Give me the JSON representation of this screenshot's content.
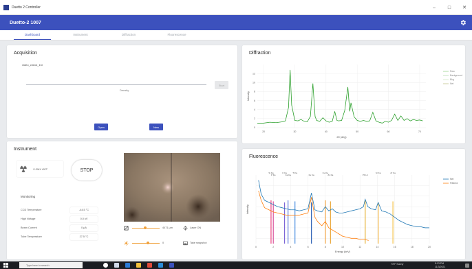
{
  "window": {
    "title": "Duetto 2 Controller",
    "minimize": "–",
    "maximize": "□",
    "close": "✕"
  },
  "appbar": {
    "title": "Duetto-2 1007",
    "settings_icon": "gear-icon"
  },
  "tabs": [
    {
      "label": "Dashboard",
      "active": true
    },
    {
      "label": "Instrument",
      "active": false
    },
    {
      "label": "Diffraction",
      "active": false
    },
    {
      "label": "Fluorescence",
      "active": false
    }
  ],
  "acquisition": {
    "title": "Acquisition",
    "filename": "video_check_1hr",
    "slider_label": "Density",
    "start_label": "Start",
    "open_label": "Open",
    "new_label": "New"
  },
  "instrument": {
    "title": "Instrument",
    "xray_label": "X-RAY OFF",
    "stop_label": "STOP",
    "monitoring_title": "Monitoring",
    "monitoring": [
      {
        "label": "CCD Temperature",
        "value": "-44.5 °C"
      },
      {
        "label": "High Voltage",
        "value": "0.0 kV"
      },
      {
        "label": "Beam Current",
        "value": "0 µA"
      },
      {
        "label": "Tube Temperature",
        "value": "27.5 °C"
      }
    ],
    "camera": {
      "focus_value": "4471 µm",
      "laser_label": "Laser ON",
      "light_value": "0",
      "snapshot_label": "Take snapshot"
    }
  },
  "diffraction": {
    "title": "Diffraction",
    "chart_data": {
      "type": "line",
      "title": "",
      "xlabel": "2θ (deg)",
      "ylabel": "Intensity",
      "xlim": [
        18,
        72
      ],
      "ylim": [
        0,
        14
      ],
      "xticks": [
        20,
        30,
        40,
        50,
        60,
        70
      ],
      "yticks": [
        0,
        2,
        4,
        6,
        8,
        10,
        12
      ],
      "legend": [
        "Raw",
        "Background",
        "Bkg",
        "Net"
      ],
      "legend_colors": [
        "#9bd48f",
        "#b8dfb0",
        "#cfe8c7",
        "#c3c58c"
      ],
      "series": [
        {
          "name": "Raw",
          "color": "#2ca02c",
          "points": [
            [
              18,
              1.0
            ],
            [
              20,
              1.0
            ],
            [
              22,
              1.2
            ],
            [
              24,
              1.1
            ],
            [
              26,
              1.3
            ],
            [
              27,
              1.5
            ],
            [
              28,
              4.5
            ],
            [
              28.5,
              12.8
            ],
            [
              29,
              5
            ],
            [
              30,
              1.6
            ],
            [
              31,
              1.5
            ],
            [
              32,
              1.8
            ],
            [
              33,
              1.4
            ],
            [
              34,
              1.3
            ],
            [
              35,
              2.5
            ],
            [
              35.8,
              9.8
            ],
            [
              36.5,
              2.5
            ],
            [
              37,
              1.6
            ],
            [
              38,
              1.4
            ],
            [
              39,
              2.2
            ],
            [
              40,
              1.5
            ],
            [
              41,
              1.2
            ],
            [
              42,
              1.4
            ],
            [
              42.8,
              3.6
            ],
            [
              43.5,
              1.6
            ],
            [
              44,
              1.5
            ],
            [
              45,
              1.6
            ],
            [
              46,
              3.8
            ],
            [
              47,
              9.0
            ],
            [
              47.6,
              3.6
            ],
            [
              48,
              5.5
            ],
            [
              49,
              2.4
            ],
            [
              50,
              1.6
            ],
            [
              51,
              1.4
            ],
            [
              52,
              1.6
            ],
            [
              53,
              1.4
            ],
            [
              54,
              1.5
            ],
            [
              55,
              3.4
            ],
            [
              56,
              1.5
            ],
            [
              57,
              1.2
            ],
            [
              58,
              1.0
            ],
            [
              59,
              1.4
            ],
            [
              60,
              1.2
            ],
            [
              61,
              1.6
            ],
            [
              62,
              3.0
            ],
            [
              63,
              1.6
            ],
            [
              64,
              2.6
            ],
            [
              65,
              1.6
            ],
            [
              66,
              2.0
            ],
            [
              67,
              1.5
            ],
            [
              68,
              1.8
            ],
            [
              69,
              1.6
            ],
            [
              70,
              1.7
            ],
            [
              71,
              1.5
            ]
          ]
        }
      ]
    }
  },
  "fluorescence": {
    "title": "Fluorescence",
    "chart_data": {
      "type": "line",
      "title": "",
      "xlabel": "Energy (keV)",
      "ylabel": "Intensity",
      "log_scale_y": true,
      "xlim": [
        0,
        20
      ],
      "xticks": [
        0,
        2,
        4,
        6,
        8,
        10,
        12,
        14,
        16,
        18,
        20
      ],
      "legend": [
        "Net",
        "Filtered"
      ],
      "peak_labels": [
        {
          "label": "Si Ka",
          "x": 1.74
        },
        {
          "label": "P Ka",
          "x": 2.0
        },
        {
          "label": "K Ka",
          "x": 3.3
        },
        {
          "label": "Ca Ka",
          "x": 3.7
        },
        {
          "label": "Ti Ka",
          "x": 4.5
        },
        {
          "label": "Fe Ka",
          "x": 6.4
        },
        {
          "label": "Cu Ka",
          "x": 8.0
        },
        {
          "label": "Zn Ka",
          "x": 8.6
        },
        {
          "label": "Sr Ka",
          "x": 14.1
        },
        {
          "label": "Pb Lb",
          "x": 12.6
        },
        {
          "label": "Zr Ka",
          "x": 15.8
        }
      ],
      "series": [
        {
          "name": "Net",
          "color": "#1f77b4",
          "points": [
            [
              0.3,
              6.5
            ],
            [
              0.6,
              5.2
            ],
            [
              1,
              4.6
            ],
            [
              1.5,
              4.4
            ],
            [
              2,
              4.2
            ],
            [
              2.5,
              4.0
            ],
            [
              3,
              3.9
            ],
            [
              3.5,
              3.8
            ],
            [
              4,
              3.7
            ],
            [
              4.5,
              3.7
            ],
            [
              5,
              3.6
            ],
            [
              5.5,
              3.7
            ],
            [
              6,
              3.8
            ],
            [
              6.4,
              5.3
            ],
            [
              6.8,
              3.7
            ],
            [
              7.1,
              3.6
            ],
            [
              7.6,
              3.5
            ],
            [
              8,
              4.0
            ],
            [
              8.4,
              3.6
            ],
            [
              8.8,
              3.8
            ],
            [
              9.2,
              3.5
            ],
            [
              9.6,
              3.4
            ],
            [
              10,
              3.4
            ],
            [
              10.5,
              3.5
            ],
            [
              11,
              3.6
            ],
            [
              11.5,
              3.7
            ],
            [
              12,
              3.8
            ],
            [
              12.4,
              4.0
            ],
            [
              12.6,
              4.7
            ],
            [
              12.9,
              4.0
            ],
            [
              13.3,
              3.8
            ],
            [
              13.8,
              3.7
            ],
            [
              14.1,
              4.4
            ],
            [
              14.5,
              3.6
            ],
            [
              15,
              3.5
            ],
            [
              15.5,
              3.3
            ],
            [
              16,
              3.0
            ],
            [
              16.5,
              2.7
            ],
            [
              17,
              2.5
            ],
            [
              17.5,
              2.3
            ],
            [
              18,
              2.2
            ],
            [
              18.5,
              2.1
            ],
            [
              19,
              2.1
            ],
            [
              19.5,
              2.0
            ],
            [
              20,
              2.0
            ]
          ]
        },
        {
          "name": "Filtered",
          "color": "#ff7f0e",
          "points": [
            [
              0.3,
              5.5
            ],
            [
              0.6,
              4.6
            ],
            [
              1,
              3.9
            ],
            [
              1.5,
              3.7
            ],
            [
              2,
              3.5
            ],
            [
              2.5,
              3.4
            ],
            [
              3,
              3.3
            ],
            [
              3.5,
              3.2
            ],
            [
              4,
              3.2
            ],
            [
              4.5,
              3.2
            ],
            [
              5,
              3.2
            ],
            [
              5.5,
              3.3
            ],
            [
              6,
              3.4
            ],
            [
              6.4,
              4.9
            ],
            [
              6.8,
              3.0
            ],
            [
              7.1,
              2.6
            ],
            [
              7.6,
              2.2
            ],
            [
              8,
              2.6
            ],
            [
              8.4,
              2.0
            ],
            [
              8.8,
              1.8
            ],
            [
              9.2,
              1.6
            ],
            [
              9.6,
              1.4
            ],
            [
              10,
              1.2
            ],
            [
              10.5,
              1.1
            ],
            [
              11,
              1.0
            ],
            [
              11.5,
              1.0
            ],
            [
              12,
              0.9
            ],
            [
              12.5,
              0.9
            ],
            [
              13,
              0.8
            ]
          ]
        }
      ]
    }
  },
  "taskbar": {
    "search_placeholder": "Type here to search",
    "tray_weather": "73°F Sunny",
    "tray_time": "5:13 PM",
    "tray_date": "11/3/2021"
  }
}
